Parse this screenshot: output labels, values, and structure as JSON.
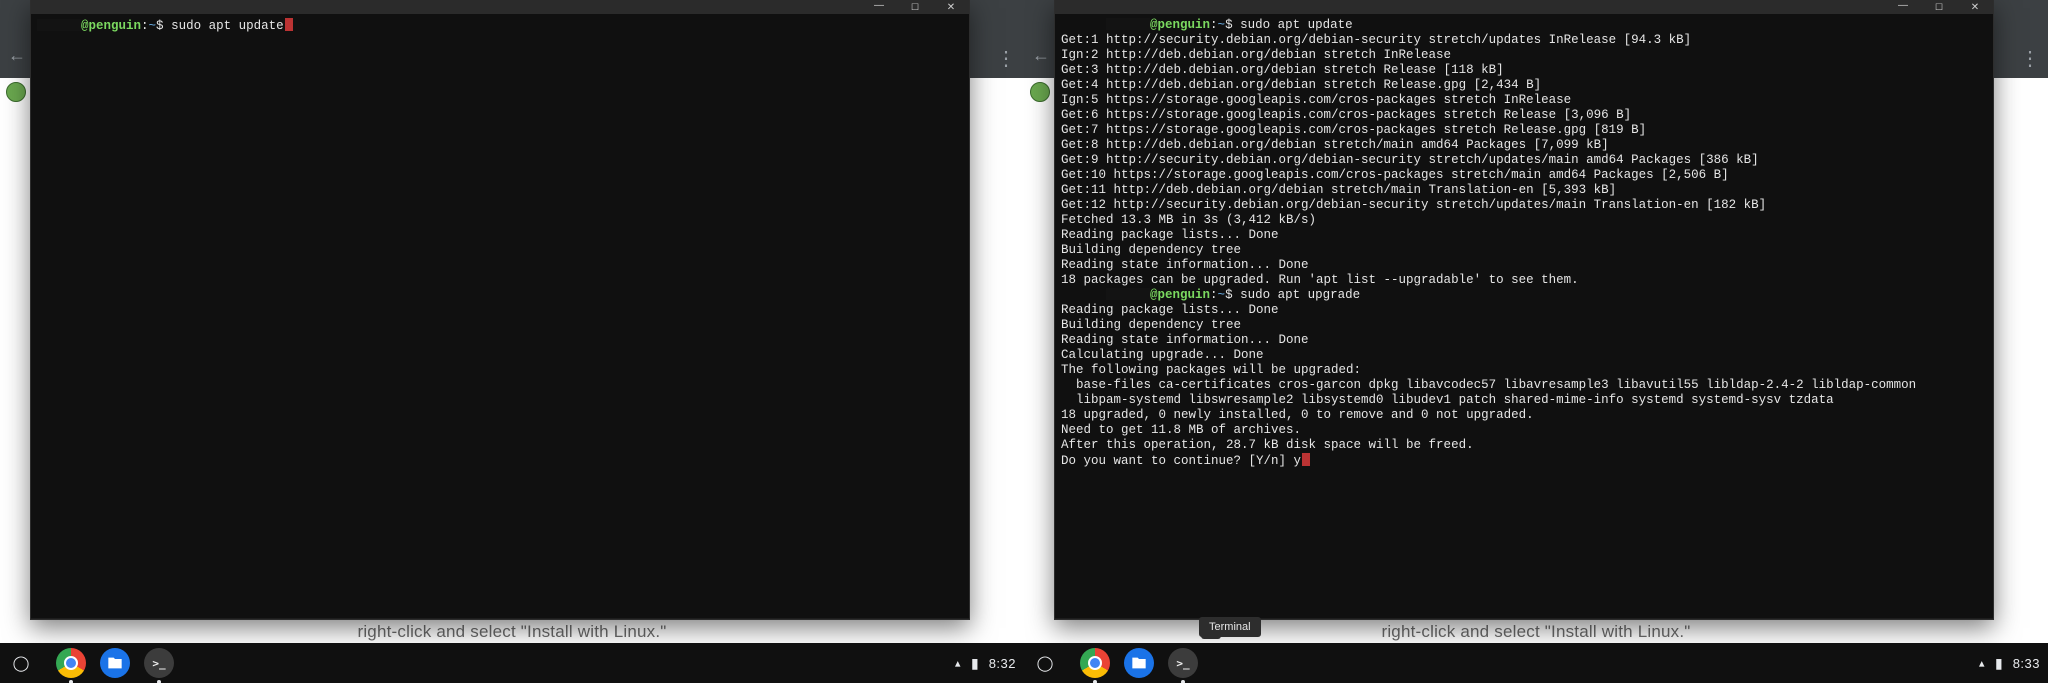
{
  "left": {
    "window_controls": {
      "minimize": "—",
      "maximize": "☐",
      "close": "✕"
    },
    "prompt": {
      "user_at_host": "@penguin",
      "path": "~",
      "sep": "$"
    },
    "command": "sudo apt update",
    "page_hint": "right-click and select \"Install with Linux.\"",
    "shelf": {
      "apps": [
        "chrome",
        "files",
        "terminal"
      ],
      "time": "8:32"
    }
  },
  "right": {
    "window_controls": {
      "minimize": "—",
      "maximize": "☐",
      "close": "✕"
    },
    "prompt1": {
      "user_at_host": "@penguin",
      "path": "~",
      "sep": "$",
      "command": "sudo apt update"
    },
    "apt_update_output": [
      "Get:1 http://security.debian.org/debian-security stretch/updates InRelease [94.3 kB]",
      "Ign:2 http://deb.debian.org/debian stretch InRelease",
      "Get:3 http://deb.debian.org/debian stretch Release [118 kB]",
      "Get:4 http://deb.debian.org/debian stretch Release.gpg [2,434 B]",
      "Ign:5 https://storage.googleapis.com/cros-packages stretch InRelease",
      "Get:6 https://storage.googleapis.com/cros-packages stretch Release [3,096 B]",
      "Get:7 https://storage.googleapis.com/cros-packages stretch Release.gpg [819 B]",
      "Get:8 http://deb.debian.org/debian stretch/main amd64 Packages [7,099 kB]",
      "Get:9 http://security.debian.org/debian-security stretch/updates/main amd64 Packages [386 kB]",
      "Get:10 https://storage.googleapis.com/cros-packages stretch/main amd64 Packages [2,506 B]",
      "Get:11 http://deb.debian.org/debian stretch/main Translation-en [5,393 kB]",
      "Get:12 http://security.debian.org/debian-security stretch/updates/main Translation-en [182 kB]",
      "Fetched 13.3 MB in 3s (3,412 kB/s)",
      "Reading package lists... Done",
      "Building dependency tree",
      "Reading state information... Done",
      "18 packages can be upgraded. Run 'apt list --upgradable' to see them."
    ],
    "prompt2": {
      "user_at_host": "@penguin",
      "path": "~",
      "sep": "$",
      "command": "sudo apt upgrade"
    },
    "apt_upgrade_output": [
      "Reading package lists... Done",
      "Building dependency tree",
      "Reading state information... Done",
      "Calculating upgrade... Done",
      "The following packages will be upgraded:",
      "  base-files ca-certificates cros-garcon dpkg libavcodec57 libavresample3 libavutil55 libldap-2.4-2 libldap-common",
      "  libpam-systemd libswresample2 libsystemd0 libudev1 patch shared-mime-info systemd systemd-sysv tzdata",
      "18 upgraded, 0 newly installed, 0 to remove and 0 not upgraded.",
      "Need to get 11.8 MB of archives.",
      "After this operation, 28.7 kB disk space will be freed.",
      "Do you want to continue? [Y/n] y"
    ],
    "tooltip": "Terminal",
    "page_hint": "right-click and select \"Install with Linux.\"",
    "shelf": {
      "apps": [
        "chrome",
        "files",
        "terminal"
      ],
      "time": "8:33"
    }
  }
}
